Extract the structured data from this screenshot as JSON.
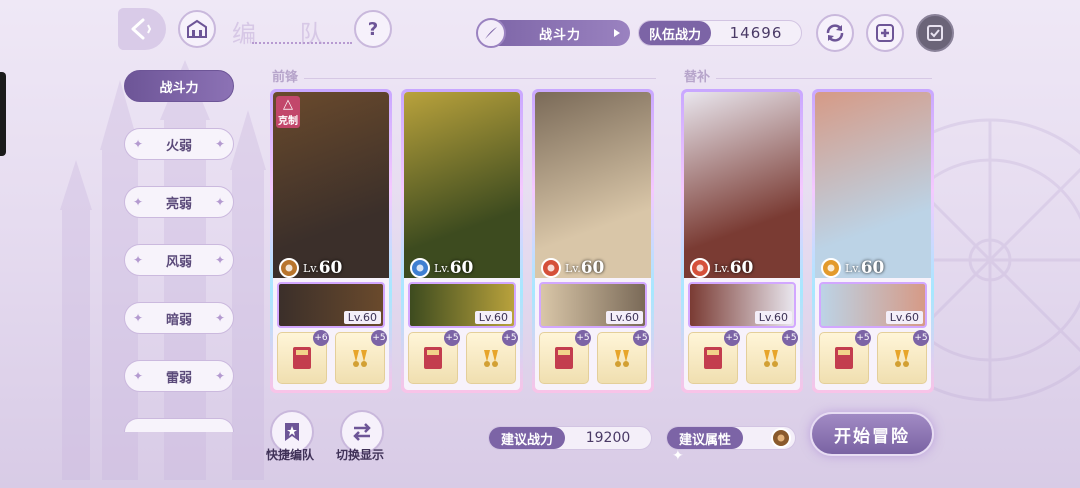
{
  "header": {
    "title": "编 队",
    "help_label": "?",
    "sort": {
      "label": "战斗力"
    },
    "team_power": {
      "label": "队伍战力",
      "value": "14696"
    }
  },
  "filters": [
    {
      "label": "战斗力",
      "active": true
    },
    {
      "label": "火弱",
      "active": false
    },
    {
      "label": "亮弱",
      "active": false
    },
    {
      "label": "风弱",
      "active": false
    },
    {
      "label": "暗弱",
      "active": false
    },
    {
      "label": "雷弱",
      "active": false
    }
  ],
  "sections": {
    "front": "前锋",
    "sub": "替补"
  },
  "cards": [
    {
      "level_prefix": "Lv.",
      "level": "60",
      "element_color": "#b8742c",
      "counter_badge": "克制",
      "support_level": "Lv.60",
      "equip_plus": [
        "+6",
        "+5"
      ],
      "colors": [
        "#3b2f2a",
        "#6a4a2c"
      ]
    },
    {
      "level_prefix": "Lv.",
      "level": "60",
      "element_color": "#3f7fd1",
      "counter_badge": "",
      "support_level": "Lv.60",
      "equip_plus": [
        "+5",
        "+5"
      ],
      "colors": [
        "#3d4b1f",
        "#b9a23c"
      ]
    },
    {
      "level_prefix": "Lv.",
      "level": "60",
      "element_color": "#d5503a",
      "counter_badge": "",
      "support_level": "Lv.60",
      "equip_plus": [
        "+5",
        "+5"
      ],
      "colors": [
        "#d9c6a8",
        "#7a6a58"
      ]
    },
    {
      "level_prefix": "Lv.",
      "level": "60",
      "element_color": "#d5503a",
      "counter_badge": "",
      "support_level": "Lv.60",
      "equip_plus": [
        "+5",
        "+5"
      ],
      "colors": [
        "#7a3b33",
        "#e9e6ee"
      ]
    },
    {
      "level_prefix": "Lv.",
      "level": "60",
      "element_color": "#e39a2c",
      "counter_badge": "",
      "support_level": "Lv.60",
      "equip_plus": [
        "+5",
        "+5"
      ],
      "colors": [
        "#bcd3e6",
        "#d69a86"
      ]
    }
  ],
  "bottom": {
    "quick_team": "快捷编队",
    "switch_display": "切换显示",
    "recommended_power": {
      "label": "建议战力",
      "value": "19200"
    },
    "recommended_attr": {
      "label": "建议属性"
    },
    "start": "开始冒险"
  },
  "colors": {
    "accent": "#7c64a6",
    "accent_light": "#9a82c0"
  }
}
